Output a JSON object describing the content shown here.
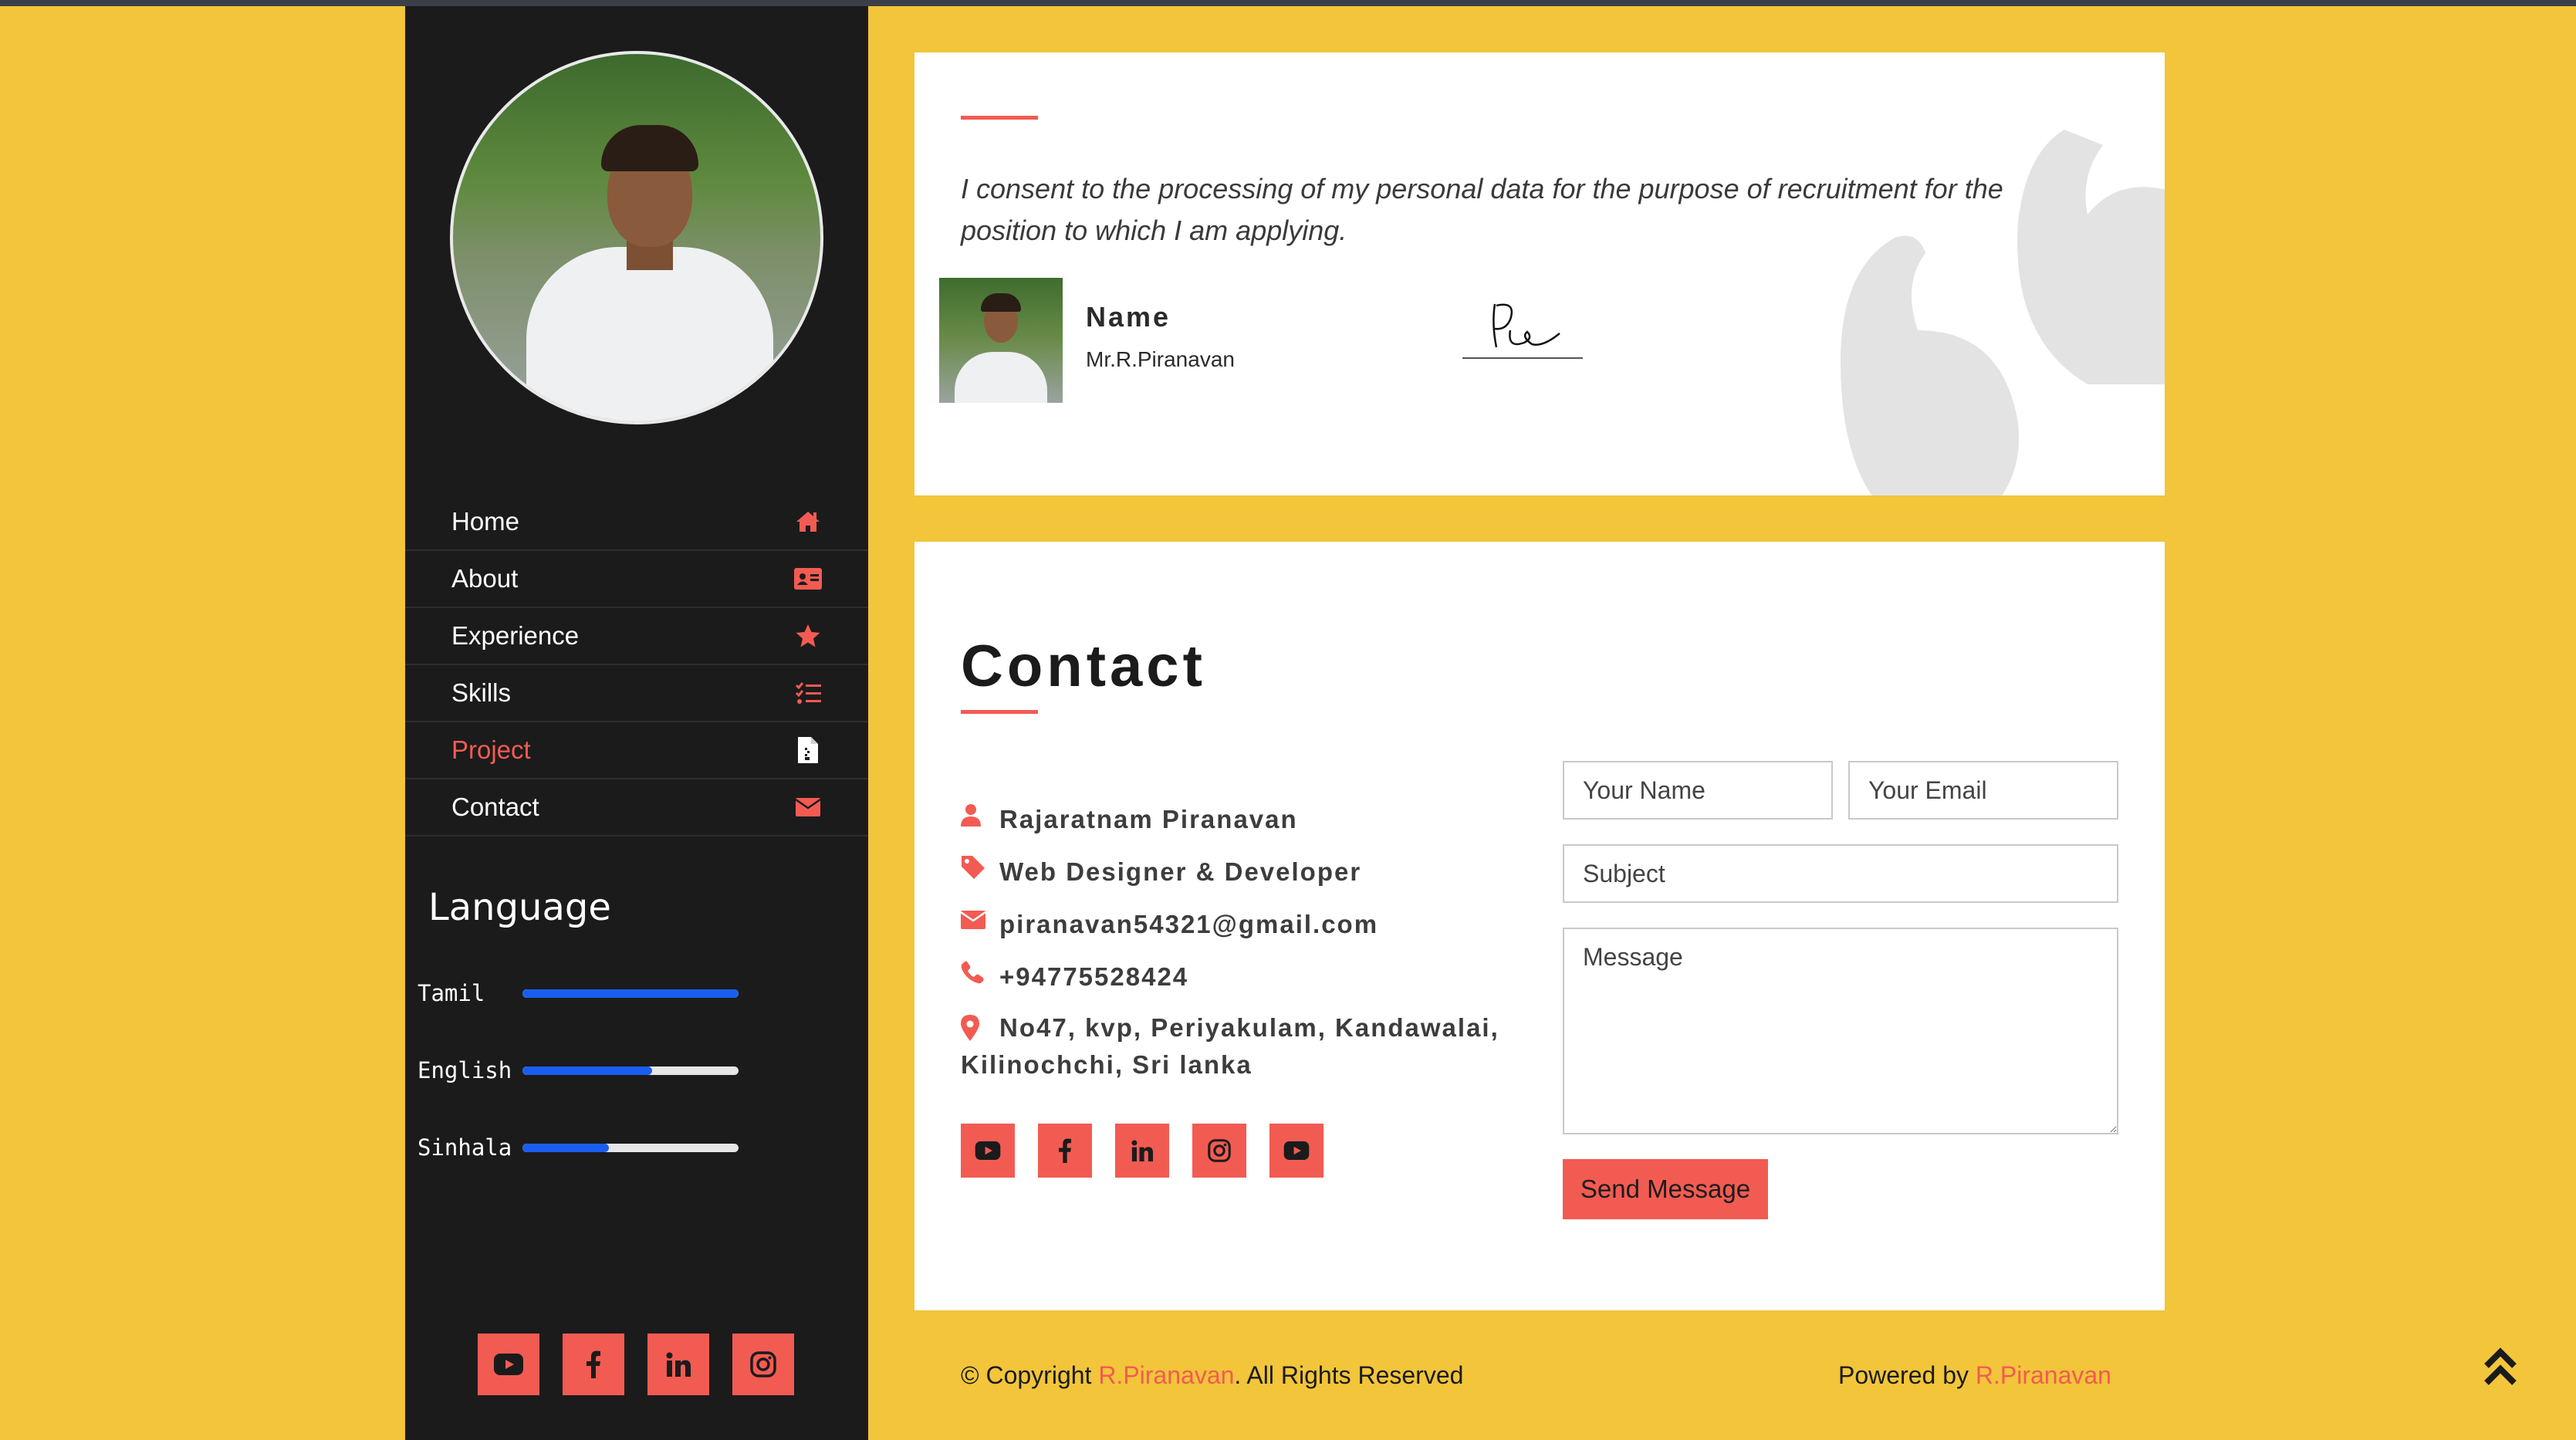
{
  "colors": {
    "background": "#f2c53a",
    "sidebar": "#1b1b1c",
    "accent": "#f25b52",
    "progress": "#1a5ef0"
  },
  "sidebar": {
    "nav": [
      {
        "label": "Home",
        "icon": "home-icon",
        "active": false
      },
      {
        "label": "About",
        "icon": "id-card-icon",
        "active": false
      },
      {
        "label": "Experience",
        "icon": "star-icon",
        "active": false
      },
      {
        "label": "Skills",
        "icon": "checklist-icon",
        "active": false
      },
      {
        "label": "Project",
        "icon": "file-icon",
        "active": true
      },
      {
        "label": "Contact",
        "icon": "envelope-icon",
        "active": false
      }
    ],
    "language_title": "Language",
    "languages": [
      {
        "name": "Tamil",
        "level": 1.0
      },
      {
        "name": "English",
        "level": 0.6
      },
      {
        "name": "Sinhala",
        "level": 0.4
      }
    ],
    "social": [
      "youtube-icon",
      "facebook-icon",
      "linkedin-icon",
      "instagram-icon"
    ]
  },
  "consent": {
    "text": "I consent to the processing of my personal data for the purpose of recruitment for the position to which I am applying.",
    "name_label": "Name",
    "name_value": "Mr.R.Piranavan"
  },
  "contact": {
    "title": "Contact",
    "name": "Rajaratnam Piranavan",
    "role": "Web Designer & Developer",
    "email": "piranavan54321@gmail.com",
    "phone": "+94775528424",
    "address": "No47, kvp, Periyakulam, Kandawalai, Kilinochchi, Sri lanka",
    "social": [
      "youtube-icon",
      "facebook-icon",
      "linkedin-icon",
      "instagram-icon",
      "youtube-icon"
    ],
    "form": {
      "name_placeholder": "Your Name",
      "email_placeholder": "Your Email",
      "subject_placeholder": "Subject",
      "message_placeholder": "Message",
      "send_label": "Send Message"
    }
  },
  "footer": {
    "copyright_prefix": "© Copyright ",
    "copyright_name": "R.Piranavan",
    "copyright_suffix": ". All Rights Reserved",
    "powered_prefix": "Powered by ",
    "powered_name": "R.Piranavan"
  }
}
